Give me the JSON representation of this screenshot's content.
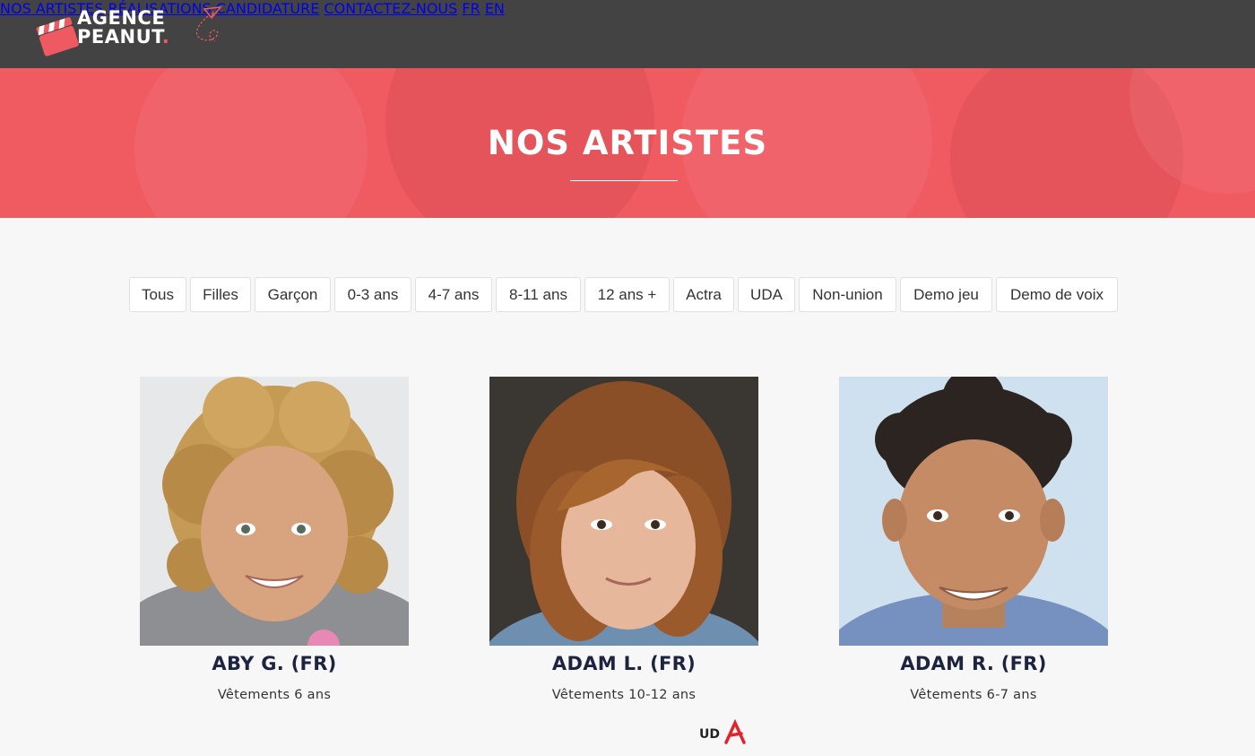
{
  "header": {
    "logo": {
      "line1": "AGENCE",
      "line2": "PEANUT",
      "dot": "."
    },
    "nav": [
      {
        "label": "NOS ARTISTES"
      },
      {
        "label": "RÉALISATIONS"
      },
      {
        "label": "CANDIDATURE"
      },
      {
        "label": "CONTACTEZ-NOUS"
      },
      {
        "label": "FR"
      },
      {
        "label": "EN"
      }
    ]
  },
  "hero": {
    "title": "NOS ARTISTES"
  },
  "filters": [
    {
      "label": "Tous"
    },
    {
      "label": "Filles"
    },
    {
      "label": "Garçon"
    },
    {
      "label": "0-3 ans"
    },
    {
      "label": "4-7 ans"
    },
    {
      "label": "8-11 ans"
    },
    {
      "label": "12 ans +"
    },
    {
      "label": "Actra"
    },
    {
      "label": "UDA"
    },
    {
      "label": "Non-union"
    },
    {
      "label": "Demo jeu"
    },
    {
      "label": "Demo de voix"
    }
  ],
  "artists": [
    {
      "name": "ABY G. (FR)",
      "detail": "Vêtements 6 ans",
      "badge": ""
    },
    {
      "name": "ADAM L. (FR)",
      "detail": "Vêtements 10-12 ans",
      "badge": "UDA"
    },
    {
      "name": "ADAM R. (FR)",
      "detail": "Vêtements 6-7 ans",
      "badge": ""
    }
  ],
  "colors": {
    "accent": "#ef5a62",
    "header_bg": "#434343",
    "hero_bg": "#f05a61",
    "name_text": "#1e2340",
    "page_bg": "#f7f7f7"
  }
}
